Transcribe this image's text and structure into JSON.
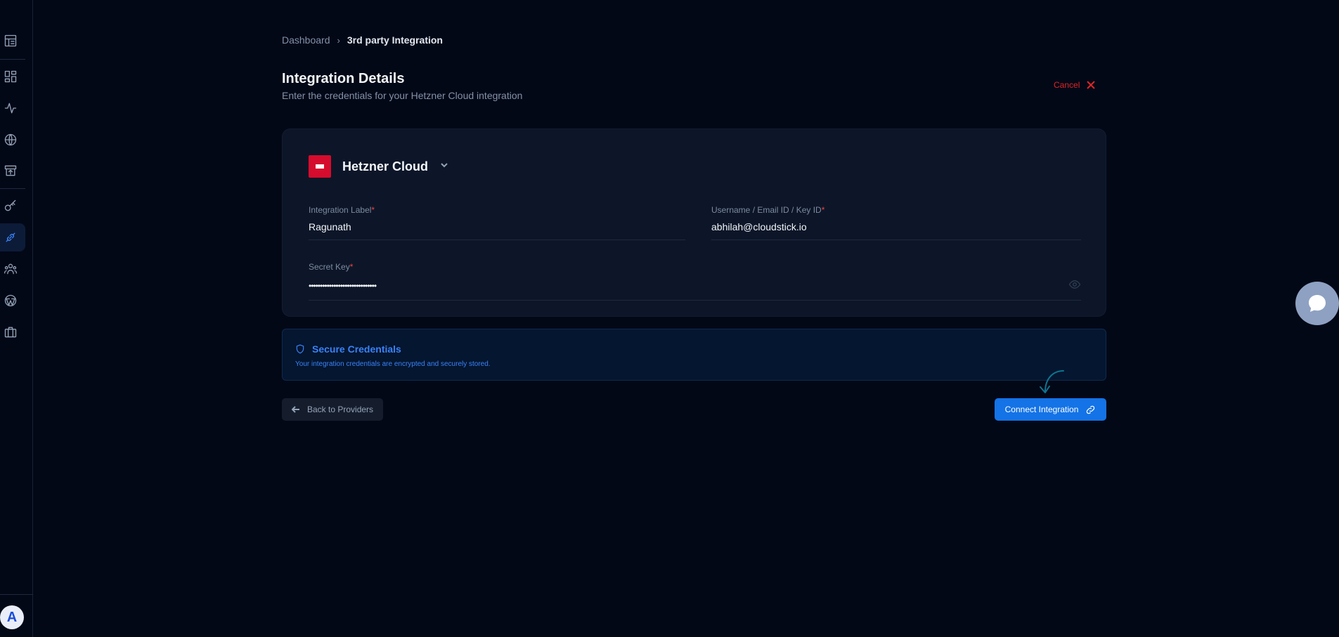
{
  "breadcrumb": {
    "parent": "Dashboard",
    "current": "3rd party Integration"
  },
  "header": {
    "title": "Integration Details",
    "subtitle": "Enter the credentials for your Hetzner Cloud integration",
    "cancel_label": "Cancel"
  },
  "provider": {
    "name": "Hetzner Cloud",
    "logo_color": "#d50c2d"
  },
  "fields": {
    "integration_label": {
      "label": "Integration Label",
      "required": "*",
      "value": "Ragunath"
    },
    "username": {
      "label": "Username / Email ID / Key ID",
      "required": "*",
      "value": "abhilah@cloudstick.io"
    },
    "secret_key": {
      "label": "Secret Key",
      "required": "*",
      "value": "••••••••••••••••••••••••••••••"
    }
  },
  "secure_notice": {
    "title": "Secure Credentials",
    "description": "Your integration credentials are encrypted and securely stored."
  },
  "actions": {
    "back_label": "Back to Providers",
    "connect_label": "Connect Integration"
  },
  "user": {
    "avatar_initial": "A"
  },
  "colors": {
    "accent": "#1473e6",
    "danger": "#dc2626",
    "background": "#030817",
    "card": "#0d1628"
  }
}
